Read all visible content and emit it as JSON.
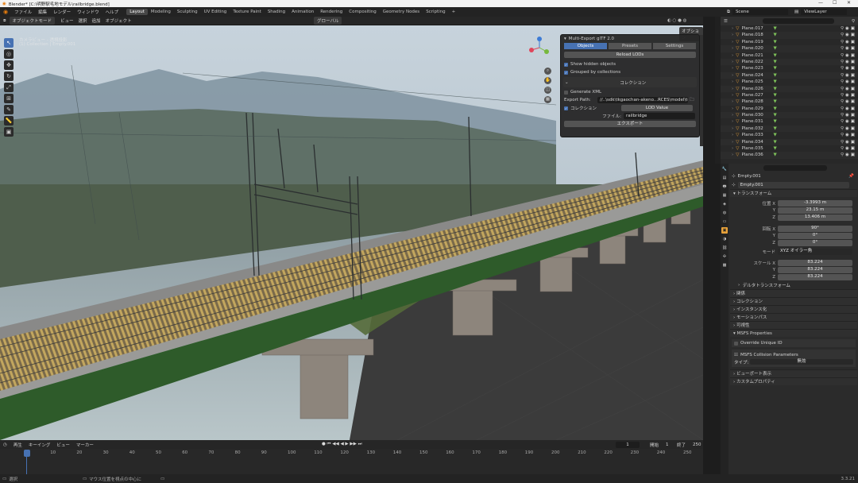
{
  "window": {
    "title": "Blender* [C:\\明野駅毛地モデル\\railbridge.blend]",
    "min": "—",
    "max": "☐",
    "close": "✕"
  },
  "menu": [
    "ファイル",
    "編集",
    "レンダー",
    "ウィンドウ",
    "ヘルプ"
  ],
  "workspaces": [
    "Layout",
    "Modeling",
    "Sculpting",
    "UV Editing",
    "Texture Paint",
    "Shading",
    "Animation",
    "Rendering",
    "Compositing",
    "Geometry Nodes",
    "Scripting",
    "+"
  ],
  "scene": {
    "icon": "scene-icon",
    "name": "Scene",
    "view_layer": "ViewLayer"
  },
  "viewport": {
    "mode": "オブジェクトモード",
    "menus": [
      "ビュー",
      "選択",
      "追加",
      "オブジェクト"
    ],
    "overlay_label": "グローバル",
    "options_label": "オプション",
    "info1": "カメラビュー - 透視投影",
    "info2": "(1) Collection | Empty.001",
    "side_tabs": [
      "アイテム",
      "ツール",
      "ビュー",
      "Multi-Export glTF 2.0"
    ]
  },
  "panel": {
    "title": "Multi-Export glTF 2.0",
    "tabs": [
      "Objects",
      "Presets",
      "Settings"
    ],
    "reload": "Reload LODs",
    "show_hidden": "Show hidden objects",
    "grouped": "Grouped by collections",
    "collection_header": "コレクション",
    "generate_xml": "Generate XML",
    "export_path_label": "Export Path:",
    "export_path": "//..\\sdk\\tkgaochan-akeno...RCES\\model\\textalbridge\\",
    "collection_label": "コレクション",
    "lod_value": "LOD Value",
    "file_label": "ファイル:",
    "file_value": "railbridge",
    "export": "エクスポート"
  },
  "outliner": {
    "items": [
      "Plane.017",
      "Plane.018",
      "Plane.019",
      "Plane.020",
      "Plane.021",
      "Plane.022",
      "Plane.023",
      "Plane.024",
      "Plane.025",
      "Plane.026",
      "Plane.027",
      "Plane.028",
      "Plane.029",
      "Plane.030",
      "Plane.031",
      "Plane.032",
      "Plane.033",
      "Plane.034",
      "Plane.035",
      "Plane.036"
    ]
  },
  "properties": {
    "object": "Empty.001",
    "datablock": "Empty.001",
    "transform": "トランスフォーム",
    "loc_label": "位置 X",
    "loc": [
      "-3.3993 m",
      "23.15 m",
      "13.406 m"
    ],
    "rot_label": "回転 X",
    "rot": [
      "90°",
      "0°",
      "0°"
    ],
    "mode_label": "モード",
    "mode": "XYZ オイラー角",
    "scale_label": "スケール X",
    "scale": [
      "83.224",
      "83.224",
      "83.224"
    ],
    "delta": "デルタトランスフォーム",
    "sections": [
      "関係",
      "コレクション",
      "インスタンス化",
      "モーションパス",
      "可視性",
      "MSFS Properties"
    ],
    "override": "Override Unique ID",
    "collision": "MSFS Collision Parameters",
    "type_label": "タイプ:",
    "type_value": "無効",
    "sections2": [
      "ビューポート表示",
      "カスタムプロパティ"
    ]
  },
  "timeline": {
    "menus": [
      "再生",
      "キーイング",
      "ビュー",
      "マーカー"
    ],
    "current": "1",
    "start_label": "開始",
    "start": "1",
    "end_label": "終了",
    "end": "250",
    "ticks": [
      "0",
      "10",
      "20",
      "30",
      "40",
      "50",
      "60",
      "70",
      "80",
      "90",
      "100",
      "110",
      "120",
      "130",
      "140",
      "150",
      "160",
      "170",
      "180",
      "190",
      "200",
      "210",
      "220",
      "230",
      "240",
      "250"
    ]
  },
  "status": {
    "select": "選択",
    "center": "マウス位置を視点の中心に",
    "version": "3.3.21"
  },
  "colors": {
    "accent": "#4772b3",
    "orange": "#e8a23a",
    "green": "#7fc35a"
  }
}
